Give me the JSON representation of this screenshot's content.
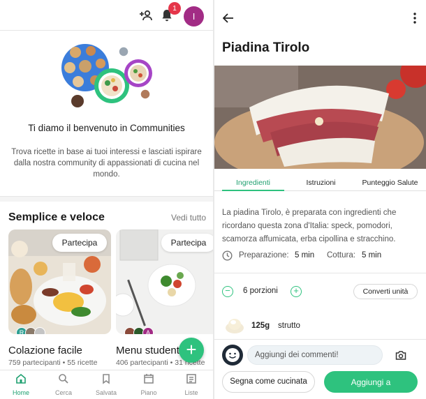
{
  "left": {
    "topbar": {
      "notification_count": "1",
      "avatar_initial": "I"
    },
    "welcome": {
      "title": "Ti diamo il benvenuto in Communities",
      "subtitle": "Trova ricette in base ai tuoi interessi e lasciati ispirare dalla nostra community di appassionati di cucina nel mondo."
    },
    "section": {
      "title": "Semplice e veloce",
      "link": "Vedi tutto"
    },
    "cards": [
      {
        "join": "Partecipa",
        "title": "Colazione facile",
        "subtitle": "759 partecipanti • 55 ricette",
        "avatars": [
          "R"
        ]
      },
      {
        "join": "Partecipa",
        "title": "Menu studenti",
        "subtitle": "406 partecipanti • 31 ricette",
        "avatars": [
          "A"
        ]
      }
    ],
    "fab": "+",
    "nav": [
      {
        "label": "Home",
        "icon": "home-icon",
        "active": true
      },
      {
        "label": "Cerca",
        "icon": "search-icon"
      },
      {
        "label": "Salvata",
        "icon": "bookmark-icon"
      },
      {
        "label": "Piano",
        "icon": "calendar-icon"
      },
      {
        "label": "Liste",
        "icon": "list-icon"
      }
    ]
  },
  "right": {
    "title": "Piadina Tirolo",
    "tabs": [
      "Ingredienti",
      "Istruzioni",
      "Punteggio Salute"
    ],
    "description": "La piadina Tirolo, è preparata con ingredienti che ricordano questa zona d'Italia: speck, pomodori, scamorza affumicata, erba cipollina e stracchino.",
    "prep_label": "Preparazione:",
    "prep_value": "5 min",
    "cook_label": "Cottura:",
    "cook_value": "5 min",
    "portions": "6 porzioni",
    "convert": "Converti unità",
    "ingredient": {
      "amount": "125g",
      "name": "strutto"
    },
    "comment_placeholder": "Aggiungi dei commenti!",
    "mark_cooked": "Segna come cucinata",
    "add_to": "Aggiungi a"
  },
  "colors": {
    "accent": "#2ec27e",
    "badge": "#e5364a",
    "avatar": "#a22c85"
  }
}
